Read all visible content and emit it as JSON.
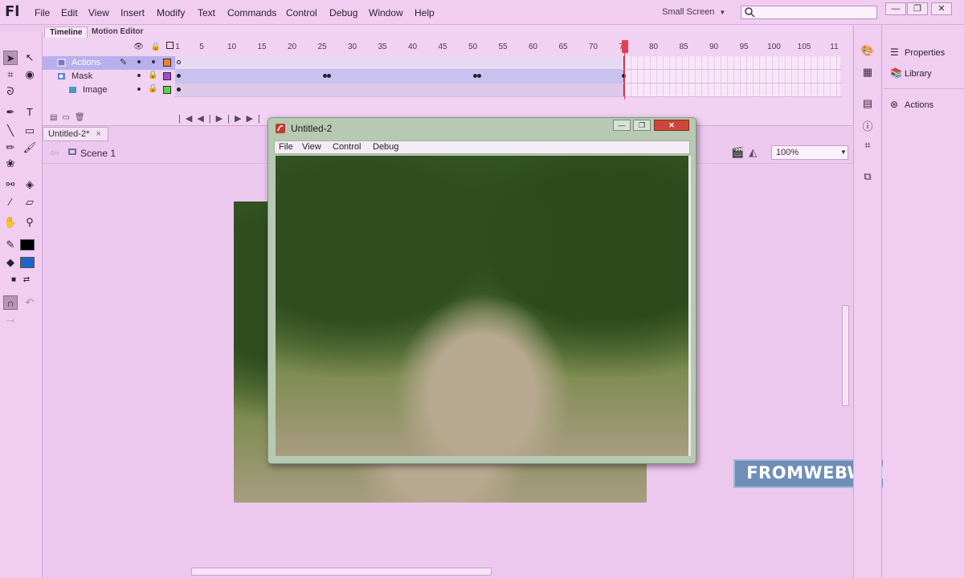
{
  "app": {
    "logo": "Fl"
  },
  "menu": [
    "File",
    "Edit",
    "View",
    "Insert",
    "Modify",
    "Text",
    "Commands",
    "Control",
    "Debug",
    "Window",
    "Help"
  ],
  "workspace": {
    "label": "Small Screen"
  },
  "search": {
    "placeholder": ""
  },
  "window_controls": {
    "minimize": "—",
    "restore": "❐",
    "close": "✕"
  },
  "timeline": {
    "tabs": [
      "Timeline",
      "Motion Editor"
    ],
    "ruler": [
      "1",
      "5",
      "10",
      "15",
      "20",
      "25",
      "30",
      "35",
      "40",
      "45",
      "50",
      "55",
      "60",
      "65",
      "70",
      "75",
      "80",
      "85",
      "90",
      "95",
      "100",
      "105",
      "11"
    ],
    "current_frame": 75,
    "layers": [
      {
        "name": "Actions",
        "selected": true,
        "color": "#e8822c"
      },
      {
        "name": "Mask",
        "selected": false,
        "color": "#a04fcf"
      },
      {
        "name": "Image",
        "selected": false,
        "color": "#5ad24a"
      }
    ]
  },
  "document": {
    "tab": "Untitled-2*",
    "tab_close": "×",
    "scene": "Scene 1",
    "zoom": "100%"
  },
  "player": {
    "title": "Untitled-2",
    "menu": [
      "File",
      "View",
      "Control",
      "Debug"
    ]
  },
  "watermark": "FROMWEBWORK",
  "panels": {
    "properties": "Properties",
    "library": "Library",
    "actions": "Actions"
  },
  "colors": {
    "stroke": "#000000",
    "fill": "#1f63c8",
    "playhead": "#e04050"
  }
}
